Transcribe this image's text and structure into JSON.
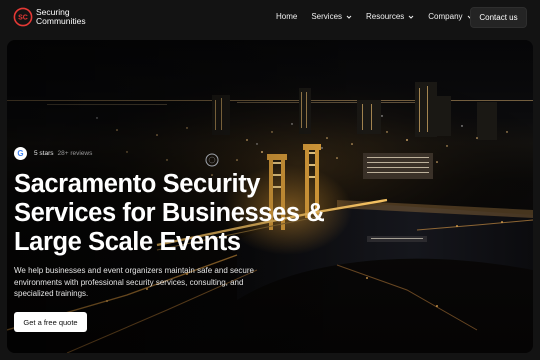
{
  "brand": {
    "logo_line1": "Securing",
    "logo_line2": "Communities",
    "accent_color": "#e53935"
  },
  "nav": {
    "items": [
      {
        "label": "Home",
        "has_dropdown": false
      },
      {
        "label": "Services",
        "has_dropdown": true
      },
      {
        "label": "Resources",
        "has_dropdown": true
      },
      {
        "label": "Company",
        "has_dropdown": true
      }
    ],
    "contact_label": "Contact us"
  },
  "hero": {
    "background_description_icon": "night-city-bridge-image",
    "review_source_icon": "google-g-icon",
    "review_source_letter": "G",
    "stars_label": "5 stars",
    "reviews_label": "28+ reviews",
    "headline_lines": [
      "Sacramento Security",
      "Services for Businesses &",
      "Large Scale Events"
    ],
    "subtext": "We help businesses and event organizers maintain safe and secure environments with professional security services, consulting, and specialized trainings.",
    "cta_label": "Get a free quote"
  }
}
